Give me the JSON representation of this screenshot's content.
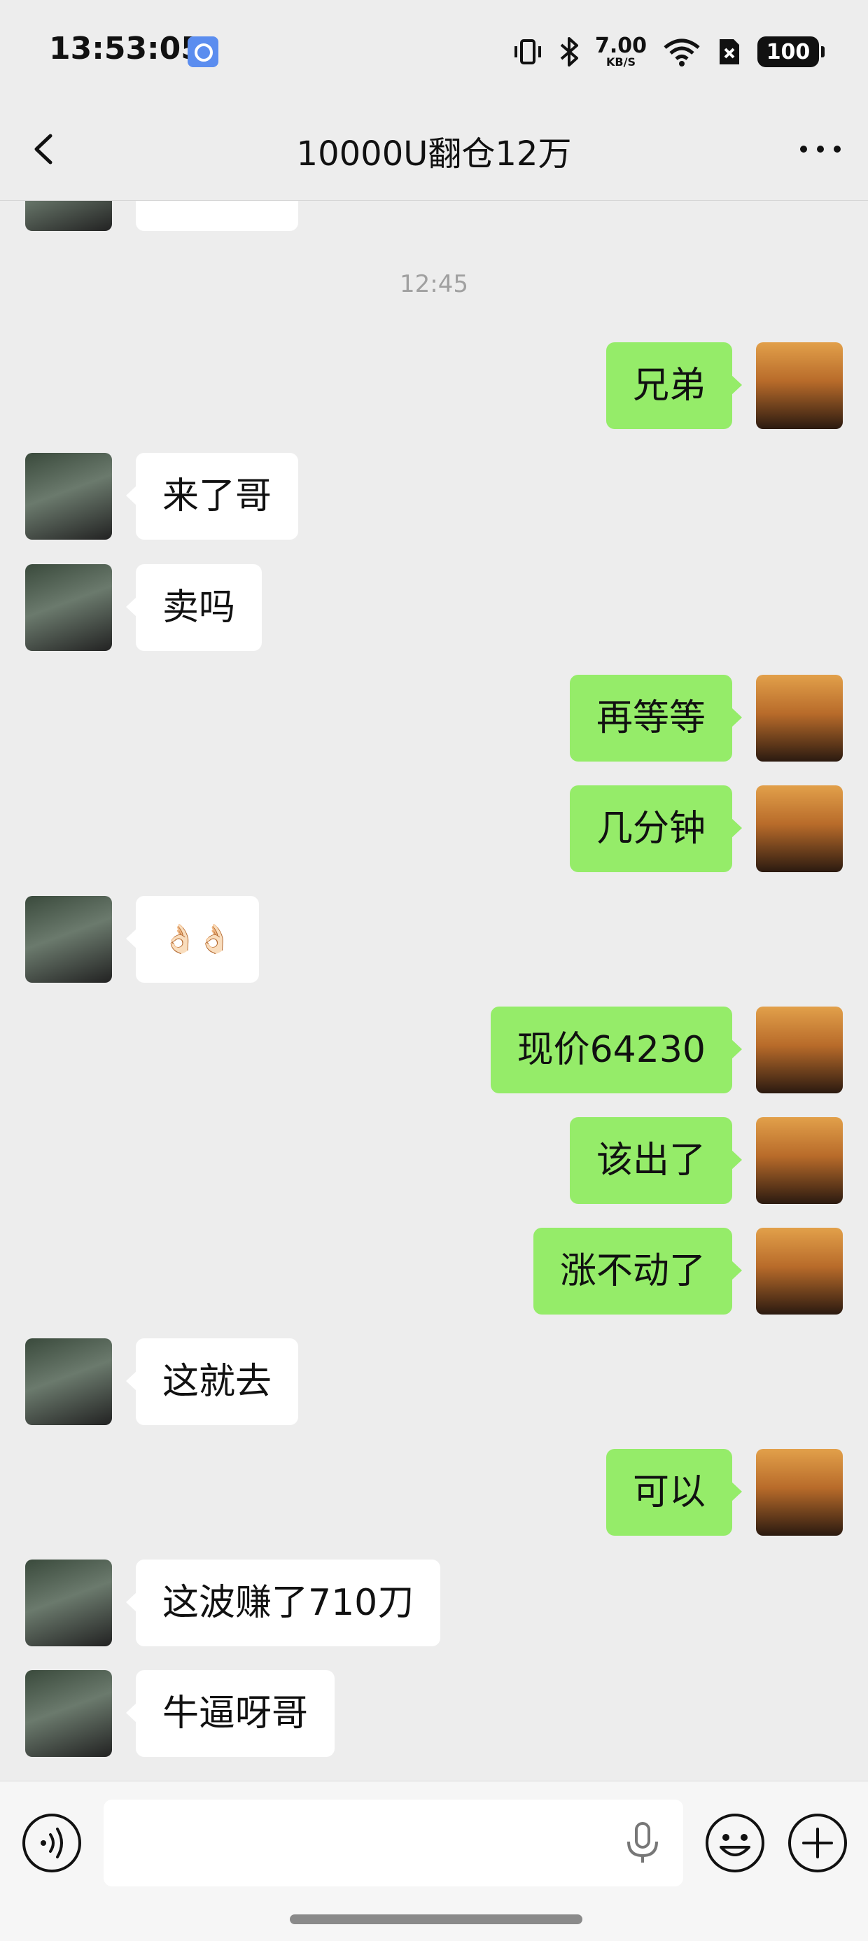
{
  "status_bar": {
    "time": "13:53:05",
    "net_speed_value": "7.00",
    "net_speed_unit": "KB/S",
    "battery": "100",
    "icons": [
      "vibrate-icon",
      "bluetooth-icon",
      "wifi-icon",
      "sim-off-icon"
    ]
  },
  "nav": {
    "title": "10000U翻仓12万",
    "back_icon": "chevron-left-icon",
    "more_icon": "ellipsis-icon"
  },
  "chat": {
    "timestamp": "12:45",
    "messages": [
      {
        "side": "right",
        "text": "兄弟"
      },
      {
        "side": "left",
        "text": "来了哥"
      },
      {
        "side": "left",
        "text": "卖吗"
      },
      {
        "side": "right",
        "text": "再等等"
      },
      {
        "side": "right",
        "text": "几分钟"
      },
      {
        "side": "left",
        "text": "👌🏻👌🏻"
      },
      {
        "side": "right",
        "text": "现价64230"
      },
      {
        "side": "right",
        "text": "该出了"
      },
      {
        "side": "right",
        "text": "涨不动了"
      },
      {
        "side": "left",
        "text": "这就去"
      },
      {
        "side": "right",
        "text": "可以"
      },
      {
        "side": "left",
        "text": "这波赚了710刀"
      },
      {
        "side": "left",
        "text": "牛逼呀哥"
      }
    ]
  },
  "input_bar": {
    "input_value": "",
    "icons": [
      "voice-icon",
      "microphone-icon",
      "emoji-icon",
      "plus-icon"
    ]
  },
  "colors": {
    "background": "#ededed",
    "own_bubble": "#95ec69",
    "other_bubble": "#ffffff",
    "timestamp_text": "#a0a0a0"
  }
}
